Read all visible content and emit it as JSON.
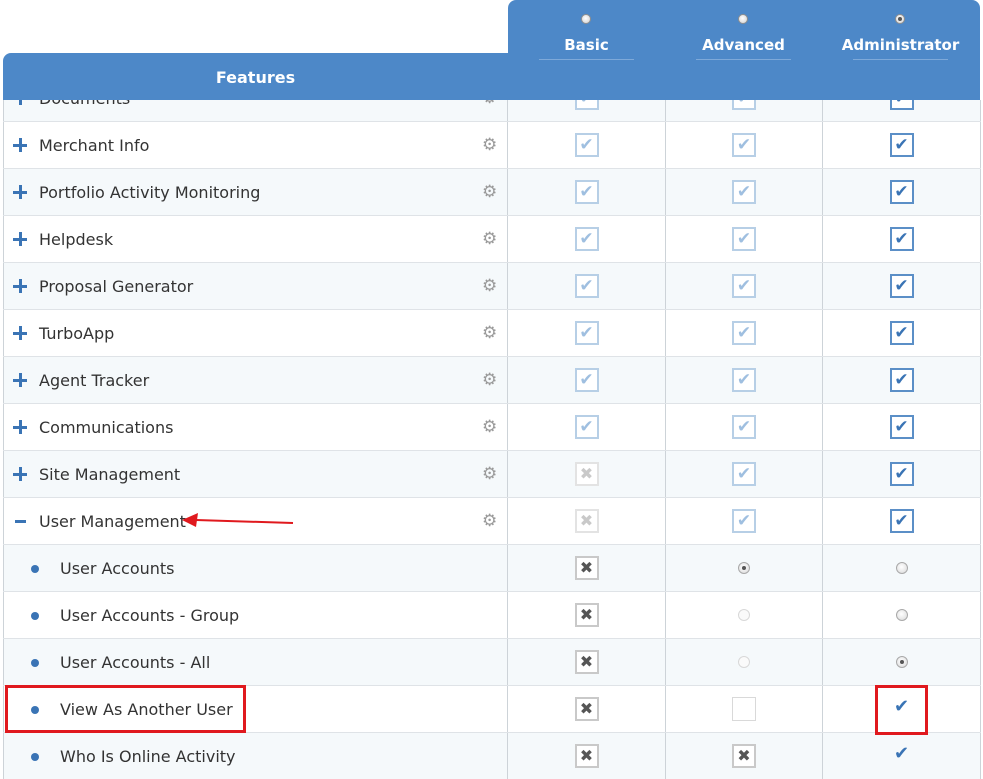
{
  "header": {
    "features_label": "Features",
    "tiers": [
      {
        "label": "Basic",
        "selected": false
      },
      {
        "label": "Advanced",
        "selected": false
      },
      {
        "label": "Administrator",
        "selected": true
      }
    ]
  },
  "rows": [
    {
      "type": "feature",
      "label": "Documents",
      "cells": [
        "check-faded",
        "check-faded",
        "check"
      ]
    },
    {
      "type": "feature",
      "label": "Merchant Info",
      "cells": [
        "check-faded",
        "check-faded",
        "check"
      ]
    },
    {
      "type": "feature",
      "label": "Portfolio Activity Monitoring",
      "cells": [
        "check-faded",
        "check-faded",
        "check"
      ]
    },
    {
      "type": "feature",
      "label": "Helpdesk",
      "cells": [
        "check-faded",
        "check-faded",
        "check"
      ]
    },
    {
      "type": "feature",
      "label": "Proposal Generator",
      "cells": [
        "check-faded",
        "check-faded",
        "check"
      ]
    },
    {
      "type": "feature",
      "label": "TurboApp",
      "cells": [
        "check-faded",
        "check-faded",
        "check"
      ]
    },
    {
      "type": "feature",
      "label": "Agent Tracker",
      "cells": [
        "check-faded",
        "check-faded",
        "check"
      ]
    },
    {
      "type": "feature",
      "label": "Communications",
      "cells": [
        "check-faded",
        "check-faded",
        "check"
      ]
    },
    {
      "type": "feature",
      "label": "Site Management",
      "cells": [
        "x-faded",
        "check-faded",
        "check"
      ]
    },
    {
      "type": "feature-open",
      "label": "User Management",
      "cells": [
        "x-faded",
        "check-faded",
        "check"
      ]
    },
    {
      "type": "sub",
      "label": "User Accounts",
      "cells": [
        "x",
        "radio-selected",
        "radio"
      ]
    },
    {
      "type": "sub",
      "label": "User Accounts - Group",
      "cells": [
        "x",
        "radio-faint",
        "radio"
      ]
    },
    {
      "type": "sub",
      "label": "User Accounts - All",
      "cells": [
        "x",
        "radio-faint",
        "radio-selected"
      ]
    },
    {
      "type": "sub",
      "label": "View As Another User",
      "cells": [
        "x",
        "empty",
        "check-plain"
      ]
    },
    {
      "type": "sub",
      "label": "Who Is Online Activity",
      "cells": [
        "x",
        "x",
        "check-plain"
      ]
    }
  ],
  "icons": {
    "check": "✔",
    "x": "✖",
    "gear": "⚙"
  }
}
